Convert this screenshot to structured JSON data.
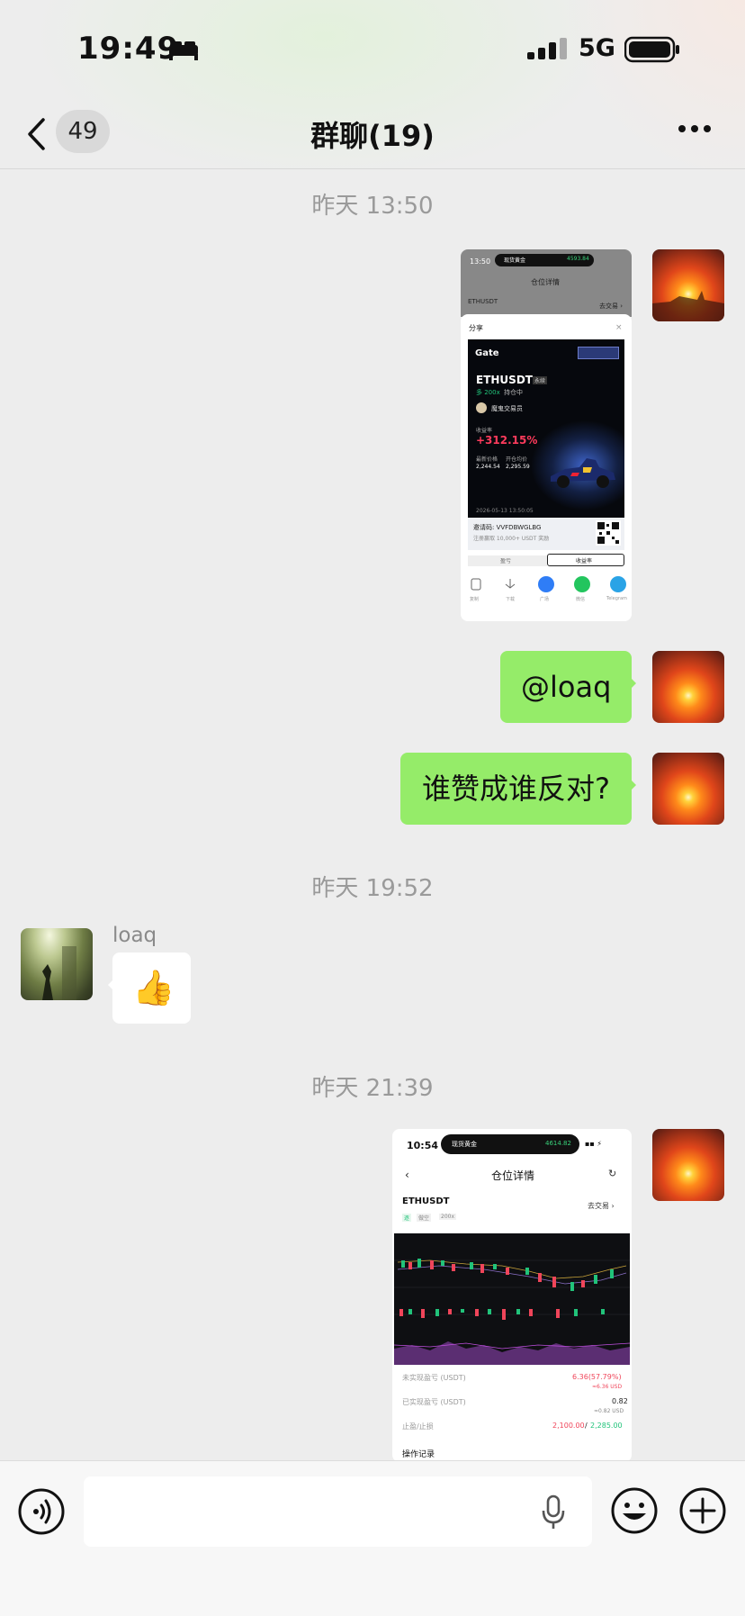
{
  "status_bar": {
    "time": "19:49",
    "network": "5G"
  },
  "nav": {
    "unread_count": "49",
    "title": "群聊(19)"
  },
  "timestamps": [
    "昨天 13:50",
    "昨天 19:52",
    "昨天 21:39"
  ],
  "messages": {
    "mention": "@loaq",
    "question": "谁赞成谁反对?",
    "sender_name": "loaq",
    "thumbs": "👍"
  },
  "share_card": {
    "top_time": "13:50",
    "island_label": "现货黄金",
    "island_value": "4593.84",
    "header": "仓位详情",
    "pair_small": "ETHUSDT",
    "go_trade": "去交易 ›",
    "share_title": "分享",
    "brand": "Gate",
    "pair": "ETHUSDT",
    "pair_tag": "永续",
    "leverage": "多 200x",
    "holding": "持仓中",
    "trader": "魔鬼交易员",
    "roi_label": "收益率",
    "roi": "+312.15%",
    "latest_label": "最新价格",
    "open_label": "开仓均价",
    "latest": "2,244.54",
    "open": "2,295.59",
    "date": "2026-05-13 13:50:05",
    "invite_label": "邀请码: VVFDBWGLBG",
    "invite_note": "注册赢取 10,000+ USDT 奖励",
    "tab_pnl": "盈亏",
    "tab_roi": "收益率",
    "actions": [
      "复制",
      "下载",
      "广场",
      "微信",
      "Telegram"
    ]
  },
  "position_card": {
    "time": "10:54",
    "island_label": "现货黄金",
    "island_value": "4614.82",
    "header": "仓位详情",
    "pair": "ETHUSDT",
    "go_trade": "去交易 ›",
    "tags": [
      "逐",
      "做空",
      "200x"
    ],
    "unrealized_label": "未实现盈亏 (USDT)",
    "unrealized": "6.36(57.79%)",
    "unrealized_usd": "≈6.36 USD",
    "realized_label": "已实现盈亏 (USDT)",
    "realized": "0.82",
    "realized_usd": "≈0.82 USD",
    "tpsl_label": "止盈/止损",
    "tp": "2,100.00",
    "sl": "2,285.00",
    "records": "操作记录"
  },
  "colors": {
    "bubble": "#95ec69",
    "bg": "#ededed",
    "roi": "#ff3b5c",
    "up": "#21c37a",
    "down": "#f0455a"
  }
}
